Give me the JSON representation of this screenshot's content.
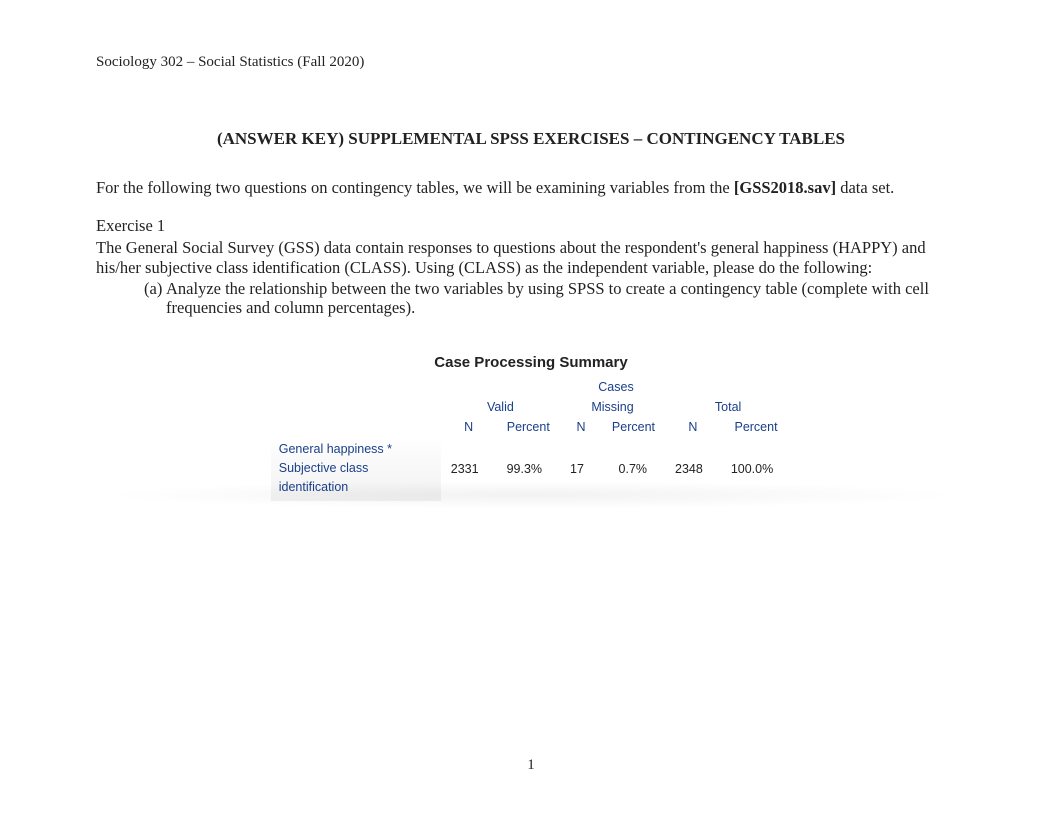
{
  "header": {
    "course": "Sociology 302 – Social Statistics (Fall 2020)"
  },
  "title": "(ANSWER KEY) SUPPLEMENTAL SPSS EXERCISES – CONTINGENCY TABLES",
  "intro": {
    "pre": "For the following two questions on contingency tables, we will be examining variables from the ",
    "dataset": "[GSS2018.sav]",
    "post": " data set."
  },
  "exercise": {
    "heading": "Exercise 1",
    "body": "The General Social Survey (GSS) data contain responses to questions about the respondent's general happiness (HAPPY) and his/her subjective class identification (CLASS). Using (CLASS) as the independent variable, please do the following:",
    "items": {
      "a": {
        "marker": "(a)",
        "text": "Analyze the relationship between the two variables by using SPSS to create a contingency table (complete with cell frequencies and column percentages)."
      }
    }
  },
  "table": {
    "title": "Case Processing Summary",
    "super_header": "Cases",
    "groups": {
      "valid": "Valid",
      "missing": "Missing",
      "total": "Total"
    },
    "cols": {
      "n": "N",
      "percent": "Percent"
    },
    "row": {
      "label": "General happiness * Subjective class identification",
      "valid_n": "2331",
      "valid_pct": "99.3%",
      "missing_n": "17",
      "missing_pct": "0.7%",
      "total_n": "2348",
      "total_pct": "100.0%"
    }
  },
  "page_number": "1"
}
